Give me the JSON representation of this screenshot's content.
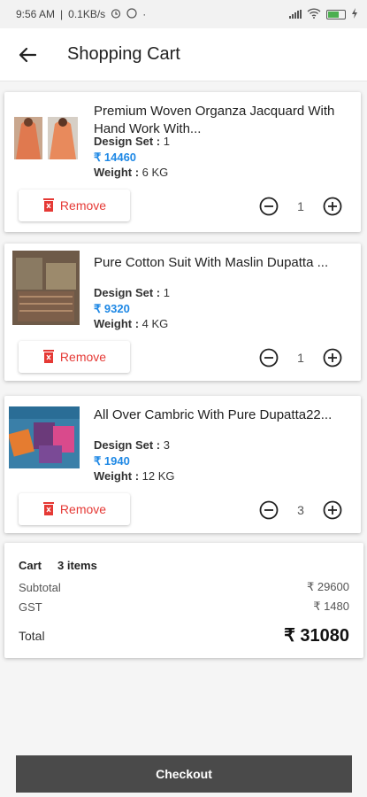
{
  "status_bar": {
    "time": "9:56 AM",
    "speed": "0.1KB/s",
    "icons": [
      "alarm-icon",
      "whatsapp-icon",
      "signal-icon",
      "wifi-icon",
      "battery-icon",
      "charging-icon"
    ]
  },
  "header": {
    "title": "Shopping Cart",
    "back_icon": "arrow-left-icon"
  },
  "cart_items": [
    {
      "title": "Premium Woven Organza Jacquard With Hand Work With...",
      "design_set_label": "Design Set : ",
      "design_set": "1",
      "price": "₹ 14460",
      "weight_label": "Weight : ",
      "weight": "6 KG",
      "remove_label": "Remove",
      "quantity": "1"
    },
    {
      "title": "Pure Cotton Suit With Maslin Dupatta ...",
      "design_set_label": "Design Set : ",
      "design_set": "1",
      "price": "₹ 9320",
      "weight_label": "Weight : ",
      "weight": "4 KG",
      "remove_label": "Remove",
      "quantity": "1"
    },
    {
      "title": "All Over Cambric With Pure Dupatta22...",
      "design_set_label": "Design Set : ",
      "design_set": "3",
      "price": "₹ 1940",
      "weight_label": "Weight : ",
      "weight": "12 KG",
      "remove_label": "Remove",
      "quantity": "3"
    }
  ],
  "summary": {
    "cart_label": "Cart",
    "items_count": "3 items",
    "subtotal_label": "Subtotal",
    "subtotal": "₹ 29600",
    "gst_label": "GST",
    "gst": "₹ 1480",
    "total_label": "Total",
    "total": "₹ 31080"
  },
  "checkout_label": "Checkout",
  "colors": {
    "price": "#1e88e5",
    "remove": "#e53935",
    "checkout_bg": "#4a4a4a"
  }
}
